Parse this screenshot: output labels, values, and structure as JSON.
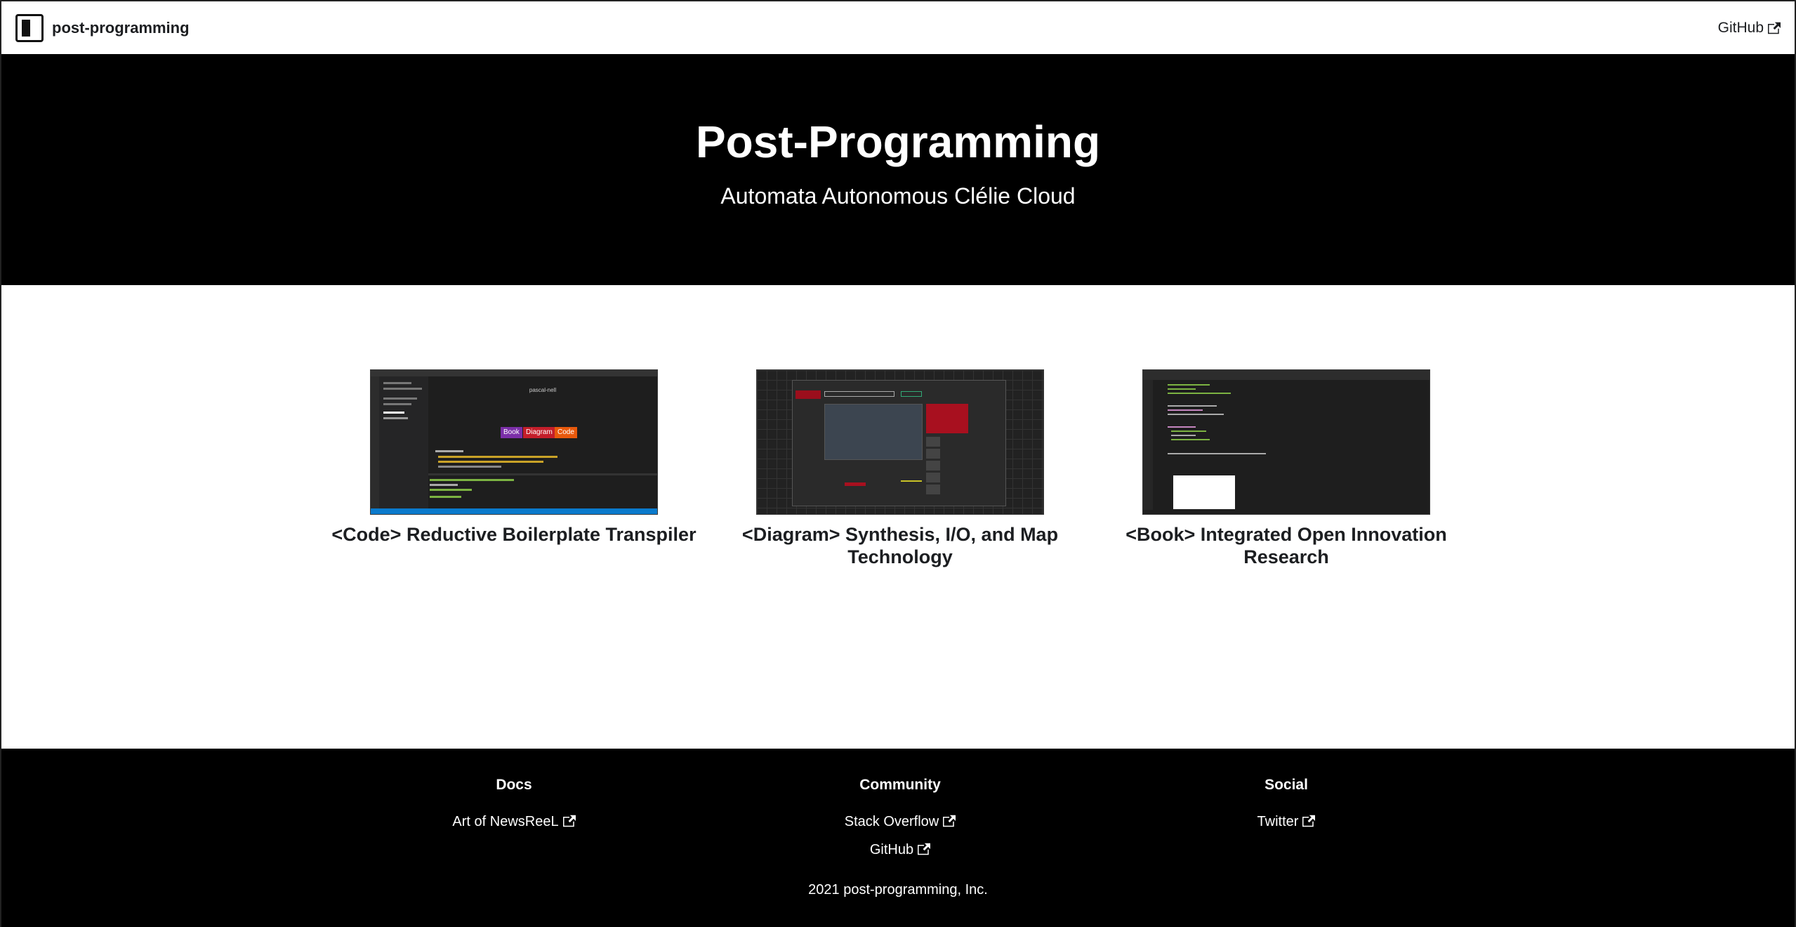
{
  "navbar": {
    "brand": "post-programming",
    "github": "GitHub"
  },
  "hero": {
    "title": "Post-Programming",
    "tagline": "Automata Autonomous Clélie Cloud"
  },
  "features": [
    {
      "title": "<Code> Reductive Boilerplate Transpiler",
      "thumb_title": "pascal-nell",
      "pills": [
        "Book",
        "Diagram",
        "Code"
      ]
    },
    {
      "title": "<Diagram> Synthesis, I/O, and Map Technology"
    },
    {
      "title": "<Book> Integrated Open Innovation Research"
    }
  ],
  "footer": {
    "columns": [
      {
        "heading": "Docs",
        "links": [
          "Art of NewsReeL"
        ]
      },
      {
        "heading": "Community",
        "links": [
          "Stack Overflow",
          "GitHub"
        ]
      },
      {
        "heading": "Social",
        "links": [
          "Twitter"
        ]
      }
    ],
    "copyright": "2021 post-programming, Inc."
  },
  "icons": {
    "external_link": "external-link-icon"
  },
  "colors": {
    "hero_bg": "#000000",
    "footer_bg": "#000000",
    "pill_book": "#7b2fa8",
    "pill_diagram": "#c41e2a",
    "pill_code": "#e8590c"
  }
}
